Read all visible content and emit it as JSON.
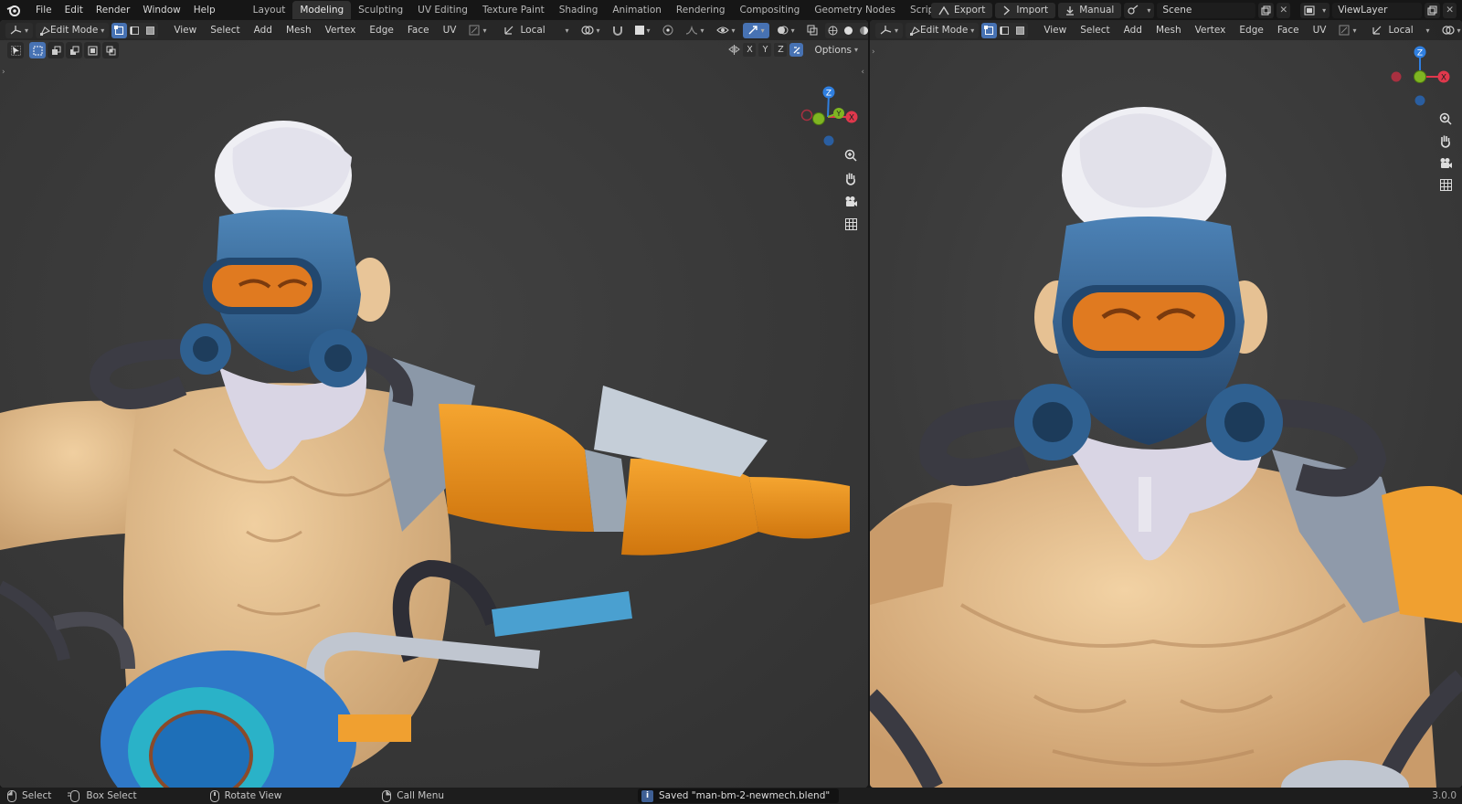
{
  "app": {
    "menus": [
      "File",
      "Edit",
      "Render",
      "Window",
      "Help"
    ],
    "workspaces": [
      "Layout",
      "Modeling",
      "Sculpting",
      "UV Editing",
      "Texture Paint",
      "Shading",
      "Animation",
      "Rendering",
      "Compositing",
      "Geometry Nodes",
      "Scripting"
    ],
    "active_workspace": "Modeling",
    "add_workspace": "+"
  },
  "topright": {
    "export_label": "Export",
    "import_label": "Import",
    "manual_label": "Manual",
    "scene_name": "Scene",
    "view_layer": "ViewLayer"
  },
  "left_viewport": {
    "mode": "Edit Mode",
    "menus": [
      "View",
      "Select",
      "Add",
      "Mesh",
      "Vertex",
      "Edge",
      "Face",
      "UV"
    ],
    "transform_orientation": "Local",
    "options_label": "Options",
    "axes": [
      "X",
      "Y",
      "Z"
    ],
    "gizmo": {
      "z": "Z",
      "y": "Y",
      "x": "X"
    }
  },
  "right_viewport": {
    "mode": "Edit Mode",
    "menus": [
      "View",
      "Select",
      "Add",
      "Mesh",
      "Vertex",
      "Edge",
      "Face",
      "UV"
    ],
    "transform_orientation": "Local",
    "gizmo": {
      "z": "Z",
      "x": "X"
    }
  },
  "statusbar": {
    "select": "Select",
    "box_select": "Box Select",
    "rotate_view": "Rotate View",
    "call_menu": "Call Menu",
    "notification": "Saved \"man-bm-2-newmech.blend\"",
    "version": "3.0.0"
  },
  "colors": {
    "accent": "#4772b3",
    "viewport_bg": "#3a3a3a",
    "axis_x": "#e0384c",
    "axis_y": "#7fb522",
    "axis_z": "#2f7fe0"
  }
}
